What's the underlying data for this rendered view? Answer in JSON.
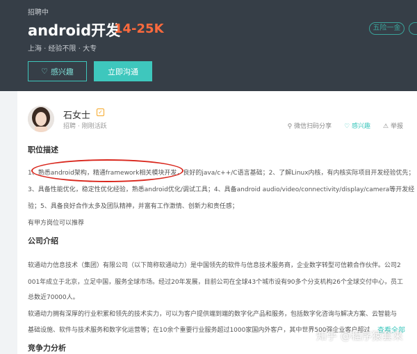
{
  "header": {
    "status": "招聘中",
    "title": "android开发",
    "salary": "14-25K",
    "meta": "上海 · 经验不限 · 大专",
    "tag": "五险一金",
    "btn_interest": "感兴趣",
    "btn_chat": "立即沟通"
  },
  "recruiter": {
    "name": "石女士",
    "role": "招聘 · 刚刚活跃",
    "share": "微信扫码分享",
    "interest": "感兴趣",
    "report": "举报"
  },
  "job": {
    "section_title": "职位描述",
    "lines": [
      "1、熟悉android架构，精通framework相关模块开发，良好的java/c++/C语言基础；2、了解Linux内核，有内核实际项目开发经验优先；",
      "3、具备性能优化，稳定性优化经验，熟悉android优化/调试工具；4、具备android audio/video/connectivity/display/camera等开发经",
      "验；5、具备良好合作太多及团队精神，并富有工作激情、创新力和责任感；",
      "有甲方岗位可以推荐"
    ]
  },
  "company": {
    "section_title": "公司介绍",
    "lines": [
      "软通动力信息技术（集团）有限公司（以下简称软通动力）是中国领先的软件与信息技术服务商，企业数字转型可信赖合作伙伴。公司2",
      "001年成立于北京，立足中国，服务全球市场。经过20年发展，目前公司在全球43个城市设有90多个分支机构26个全球交付中心，员工",
      "总数近70000人。",
      "软通动力拥有深厚的行业积累和领先的技术实力，可以为客户提供端到端的数字化产品和服务，包括数字化咨询与解决方案、云智能与",
      "基础设施、软件与技术服务和数字化运营等；在10余个重要行业服务超过1000家国内外客户，其中世界500强企业客户超过"
    ],
    "more": "查看全部"
  },
  "competition": {
    "section_title": "竞争力分析"
  },
  "watermark": "知乎 @程序猿套来"
}
